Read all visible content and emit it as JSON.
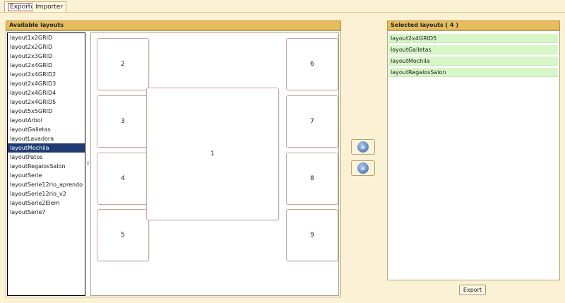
{
  "tabs": [
    {
      "label": "Exporter"
    },
    {
      "label": "Importer"
    }
  ],
  "available": {
    "title": "Available layouts",
    "items": [
      "layout1x2GRID",
      "layout2x2GRID",
      "layout2x3GRID",
      "layout2x4GRID",
      "layout2x4GRID2",
      "layout2x4GRID3",
      "layout2x4GRID4",
      "layout2x4GRID5",
      "layout5x5GRID",
      "layoutArbol",
      "layoutGalletas",
      "layoutLavadora",
      "layoutMochila",
      "layoutPatos",
      "layoutRegalosSalon",
      "layoutSerie",
      "layoutSerie12rio_aprendo",
      "layoutSerie12rio_v2",
      "layoutSerie2Elem",
      "layoutSerie7"
    ],
    "selected_item": "layoutMochila"
  },
  "preview": {
    "cells": [
      "1",
      "2",
      "3",
      "4",
      "5",
      "6",
      "7",
      "8",
      "9"
    ]
  },
  "selected": {
    "title": "Selected layouts ( 4 )",
    "items": [
      "layout2x4GRID5",
      "layoutGalletas",
      "layoutMochila",
      "layoutRegalosSalon"
    ]
  },
  "buttons": {
    "move_right_icon": "double-chevron-right-icon",
    "move_left_icon": "double-chevron-left-icon",
    "export_label": "Export"
  }
}
